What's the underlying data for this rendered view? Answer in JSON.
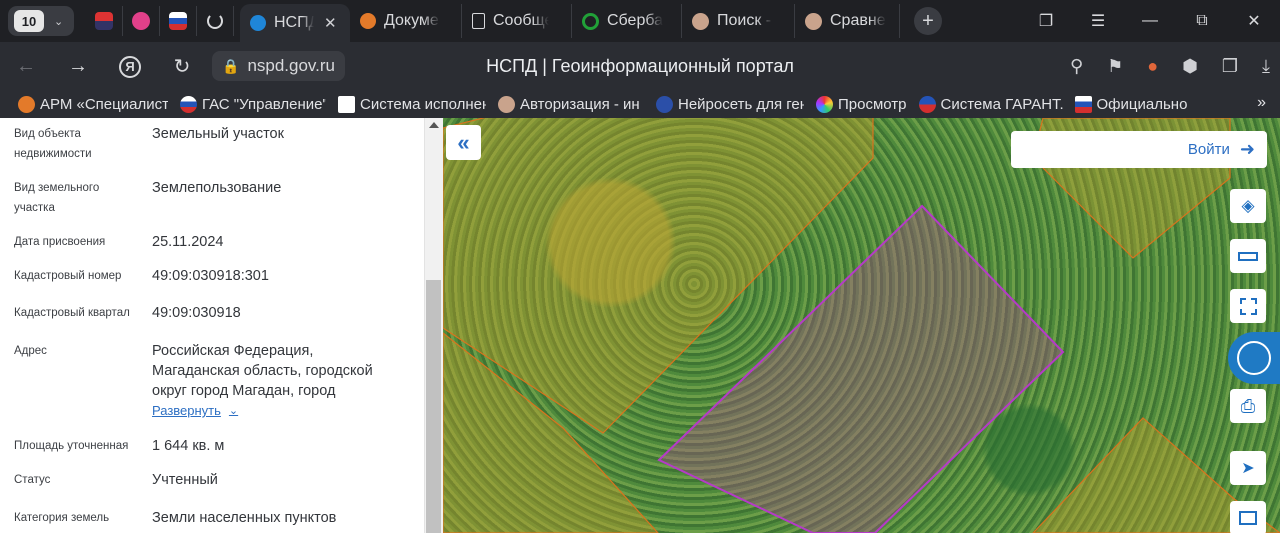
{
  "browser": {
    "tab_count": "10",
    "tabs": [
      {
        "label": "НСПД",
        "active": true
      },
      {
        "label": "Докумен"
      },
      {
        "label": "Сообще"
      },
      {
        "label": "Сбербан"
      },
      {
        "label": "Поиск -"
      },
      {
        "label": "Сравнен"
      }
    ],
    "url": "nspd.gov.ru",
    "page_title": "НСПД | Геоинформационный портал",
    "bookmarks": [
      "АРМ «Специалист",
      "ГАС \"Управление\"",
      "Система исполнен",
      "Авторизация - ин",
      "Нейросеть для ген",
      "Просмотр",
      "Система ГАРАНТ.",
      "Официально"
    ],
    "bookmarks_more": "»"
  },
  "panel": {
    "fields": [
      {
        "label": "Вид объекта недвижимости",
        "value": "Земельный участок"
      },
      {
        "label": "Вид земельного участка",
        "value": "Землепользование"
      },
      {
        "label": "Дата присвоения",
        "value": "25.11.2024"
      },
      {
        "label": "Кадастровый номер",
        "value": "49:09:030918:301"
      },
      {
        "label": "Кадастровый квартал",
        "value": "49:09:030918"
      },
      {
        "label": "Адрес",
        "value": "Российская Федерация, Магаданская область, городской округ город Магадан, город"
      },
      {
        "label": "Площадь уточненная",
        "value": "1 644 кв. м"
      },
      {
        "label": "Статус",
        "value": "Учтенный"
      },
      {
        "label": "Категория земель",
        "value": "Земли населенных пунктов"
      }
    ],
    "expand_label": "Развернуть"
  },
  "map": {
    "login_label": "Войти",
    "collapse_glyph": "«",
    "colors": {
      "selected_parcel": "#b53ac8",
      "neighbor_parcel": "#e07a1c",
      "accent": "#2d6fc3"
    }
  }
}
